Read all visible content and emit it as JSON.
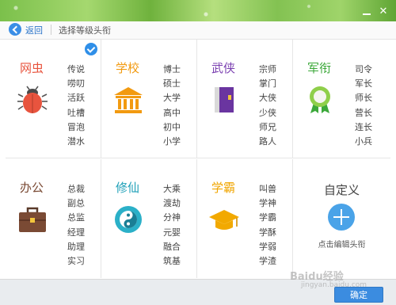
{
  "toolbar": {
    "back_label": "返回",
    "title": "选择等级头衔"
  },
  "categories": [
    {
      "title": "网虫",
      "color": "#e8543e",
      "icon": "bug-icon",
      "selected": true,
      "ranks": [
        "传说",
        "唠叨",
        "活跃",
        "吐槽",
        "冒泡",
        "潜水"
      ]
    },
    {
      "title": "学校",
      "color": "#f29a10",
      "icon": "school-building-icon",
      "ranks": [
        "博士",
        "硕士",
        "大学",
        "高中",
        "初中",
        "小学"
      ]
    },
    {
      "title": "武侠",
      "color": "#7a3fb0",
      "icon": "martial-book-icon",
      "ranks": [
        "宗师",
        "掌门",
        "大侠",
        "少侠",
        "师兄",
        "路人"
      ]
    },
    {
      "title": "军衔",
      "color": "#3ca83a",
      "icon": "military-medal-icon",
      "ranks": [
        "司令",
        "军长",
        "师长",
        "营长",
        "连长",
        "小兵"
      ]
    },
    {
      "title": "办公",
      "color": "#7a4a34",
      "icon": "briefcase-icon",
      "ranks": [
        "总裁",
        "副总",
        "总监",
        "经理",
        "助理",
        "实习"
      ]
    },
    {
      "title": "修仙",
      "color": "#1fa0b8",
      "icon": "yin-yang-icon",
      "ranks": [
        "大乘",
        "渡劫",
        "分神",
        "元婴",
        "融合",
        "筑基"
      ]
    },
    {
      "title": "学霸",
      "color": "#f0a500",
      "icon": "graduation-cap-icon",
      "ranks": [
        "叫兽",
        "学神",
        "学霸",
        "学酥",
        "学弱",
        "学渣"
      ]
    }
  ],
  "custom": {
    "title": "自定义",
    "hint": "点击编辑头衔"
  },
  "footer": {
    "confirm_label": "确定"
  },
  "watermark": {
    "main": "Baidu经验",
    "sub": "jingyan.baidu.com"
  }
}
